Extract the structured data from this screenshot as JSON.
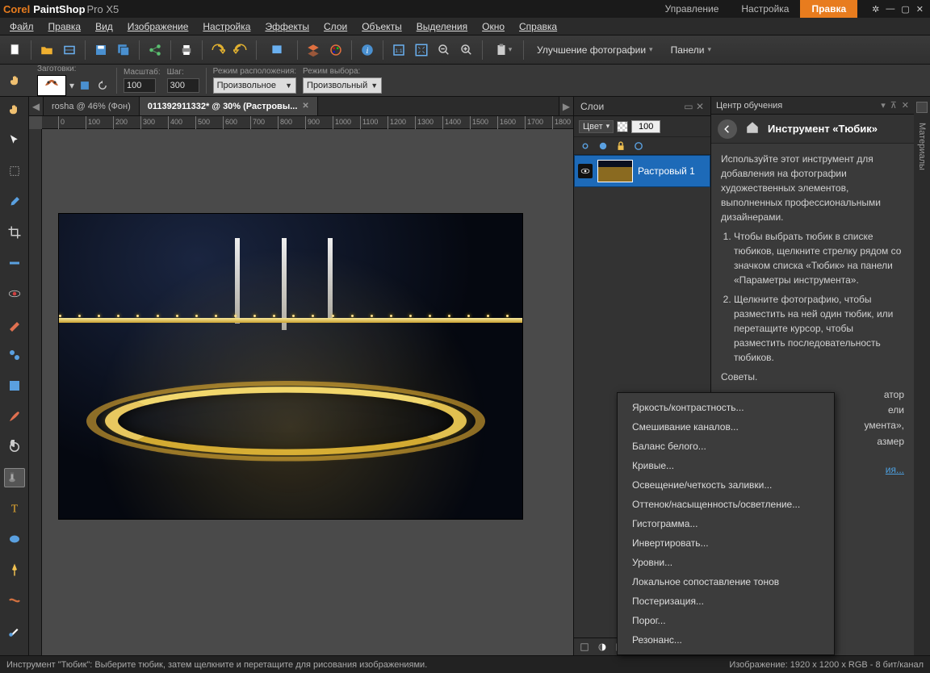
{
  "app": {
    "logo_text": "Corel",
    "name_bold": "PaintShop",
    "name_rest": "Pro X5"
  },
  "workspace_tabs": {
    "manage": "Управление",
    "adjust": "Настройка",
    "edit": "Правка"
  },
  "menu": {
    "file": "Файл",
    "edit": "Правка",
    "view": "Вид",
    "image": "Изображение",
    "adjust": "Настройка",
    "effects": "Эффекты",
    "layers": "Слои",
    "objects": "Объекты",
    "selections": "Выделения",
    "window": "Окно",
    "help": "Справка"
  },
  "toolbar": {
    "photo_fix": "Улучшение фотографии",
    "panels": "Панели"
  },
  "options": {
    "presets_label": "Заготовки:",
    "scale_label": "Масштаб:",
    "scale_value": "100",
    "step_label": "Шаг:",
    "step_value": "300",
    "placement_label": "Режим расположения:",
    "placement_value": "Произвольное",
    "selection_label": "Режим выбора:",
    "selection_value": "Произвольный"
  },
  "doc_tabs": {
    "tab1": "rosha @  46% (Фон)",
    "tab2": "011392911332* @  30% (Растровы..."
  },
  "ruler_ticks": [
    "0",
    "100",
    "200",
    "300",
    "400",
    "500",
    "600",
    "700",
    "800",
    "900",
    "1000",
    "1100",
    "1200",
    "1300",
    "1400",
    "1500",
    "1600",
    "1700",
    "1800"
  ],
  "layers_panel": {
    "title": "Слои",
    "blend_label": "Цвет",
    "opacity": "100",
    "layer0_name": "Растровый 1"
  },
  "learning": {
    "panel_title": "Центр обучения",
    "tool_title": "Инструмент «Тюбик»",
    "intro": "Используйте этот инструмент для добавления на фотографии художественных элементов, выполненных профессиональными дизайнерами.",
    "step1": "Чтобы выбрать тюбик в списке тюбиков, щелкните стрелку рядом со значком списка «Тюбик» на панели «Параметры инструмента».",
    "step2": "Щелкните фотографию, чтобы разместить на ней один тюбик, или перетащите курсор, чтобы разместить последовательность тюбиков.",
    "tips_label": "Советы.",
    "frag_a": "атор",
    "frag_b": "ели",
    "frag_c": "умента»,",
    "frag_d": "азмер",
    "link_suffix": "ия..."
  },
  "right_tab": "Материалы",
  "context_menu": {
    "brightness": "Яркость/контрастность...",
    "channel_mix": "Смешивание каналов...",
    "white_balance": "Баланс белого...",
    "curves": "Кривые...",
    "fill_light": "Освещение/четкость заливки...",
    "hsl": "Оттенок/насыщенность/осветление...",
    "histogram": "Гистограмма...",
    "invert": "Инвертировать...",
    "levels": "Уровни...",
    "local_tone": "Локальное сопоставление тонов",
    "posterize": "Постеризация...",
    "threshold": "Порог...",
    "resonance": "Резонанс..."
  },
  "statusbar": {
    "hint": "Инструмент \"Тюбик\": Выберите тюбик, затем щелкните и перетащите для рисования изображениями.",
    "image_info": "Изображение:  1920 x 1200 x RGB - 8 бит/канал"
  }
}
